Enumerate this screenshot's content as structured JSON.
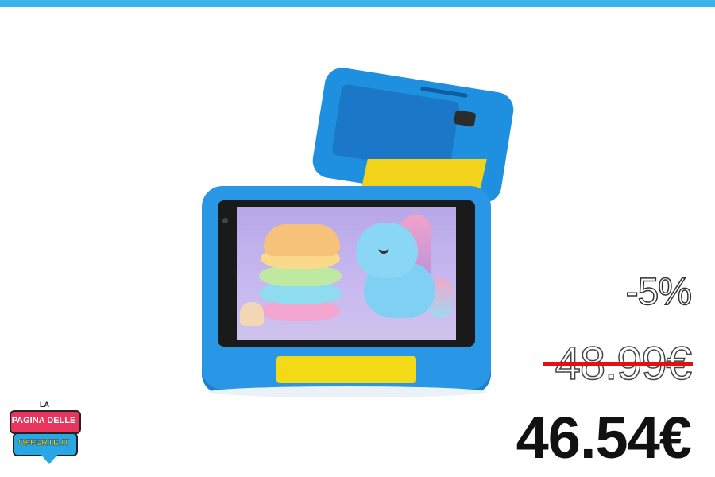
{
  "ad": {
    "discount": "-5%",
    "old_price": "48.99€",
    "new_price": "46.54€"
  },
  "logo": {
    "line1": "LA",
    "line2": "PAGINA DELLE",
    "line3": "OFFERTE.IT"
  },
  "colors": {
    "top_bar": "#3bb2ec",
    "strike": "#e40f0f",
    "tablet_case": "#2a96e6",
    "stand": "#f3d21b"
  }
}
